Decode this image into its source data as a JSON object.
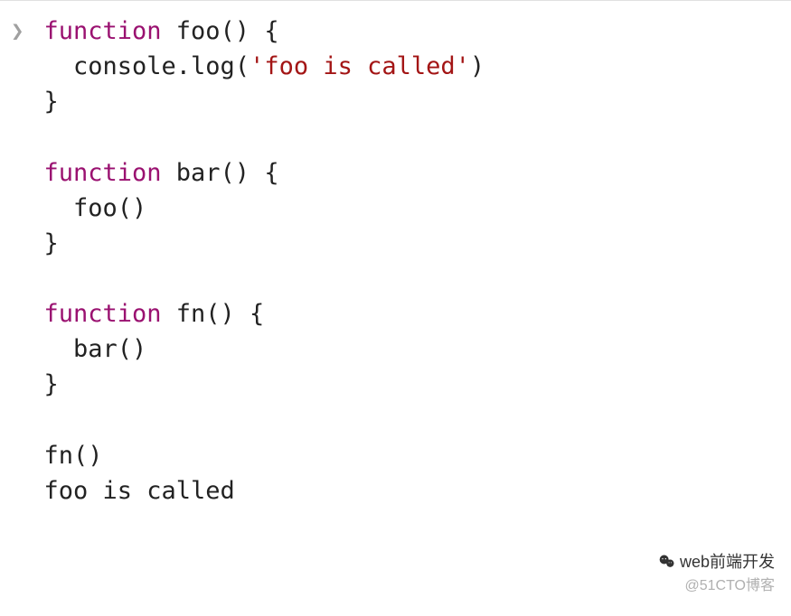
{
  "prompt_symbol": "❯",
  "code": {
    "line1": {
      "keyword": "function",
      "fn": "foo",
      "parens": "()",
      "brace": " {"
    },
    "line2": {
      "indent": "  ",
      "obj": "console",
      "dot": ".",
      "method": "log",
      "open": "(",
      "string": "'foo is called'",
      "close": ")"
    },
    "line3": "}",
    "line5": {
      "keyword": "function",
      "fn": "bar",
      "parens": "()",
      "brace": " {"
    },
    "line6": {
      "indent": "  ",
      "call": "foo()"
    },
    "line7": "}",
    "line9": {
      "keyword": "function",
      "fn": "fn",
      "parens": "()",
      "brace": " {"
    },
    "line10": {
      "indent": "  ",
      "call": "bar()"
    },
    "line11": "}",
    "line13": "fn()",
    "output": "foo is called"
  },
  "watermark": {
    "top": "web前端开发",
    "bottom": "@51CTO博客"
  }
}
